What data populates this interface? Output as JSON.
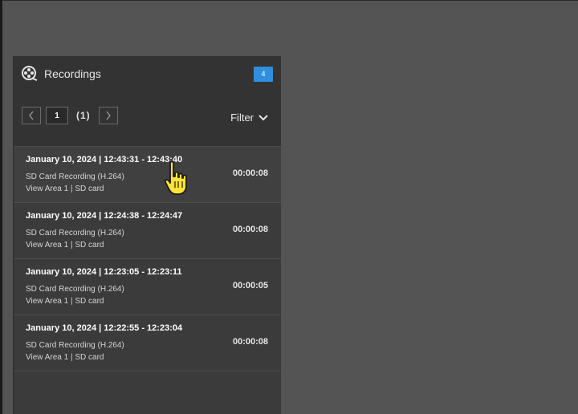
{
  "panel": {
    "title": "Recordings",
    "count_badge": "4",
    "title_icon": "film-reel-icon"
  },
  "pager": {
    "prev_icon": "chevron-left-icon",
    "current_page": "1",
    "total_pages": "(1)",
    "next_icon": "chevron-right-icon"
  },
  "filter": {
    "label": "Filter",
    "icon": "chevron-down-icon"
  },
  "recordings": [
    {
      "time": "January 10, 2024  |  12:43:31  -  12:43:40",
      "type": "SD Card Recording (H.264)",
      "area": "View Area 1  |  SD card",
      "duration": "00:00:08"
    },
    {
      "time": "January 10, 2024  |  12:24:38  -  12:24:47",
      "type": "SD Card Recording (H.264)",
      "area": "View Area 1  |  SD card",
      "duration": "00:00:08"
    },
    {
      "time": "January 10, 2024  |  12:23:05  -  12:23:11",
      "type": "SD Card Recording (H.264)",
      "area": "View Area 1  |  SD card",
      "duration": "00:00:05"
    },
    {
      "time": "January 10, 2024  |  12:22:55  -  12:23:04",
      "type": "SD Card Recording (H.264)",
      "area": "View Area 1  |  SD card",
      "duration": "00:00:08"
    }
  ],
  "colors": {
    "background": "#545454",
    "panel": "#3b3b3b",
    "header": "#333333",
    "badge": "#2f8fde",
    "cursor": "#ffe23a"
  },
  "cursor_icon": "hand-pointer-icon"
}
